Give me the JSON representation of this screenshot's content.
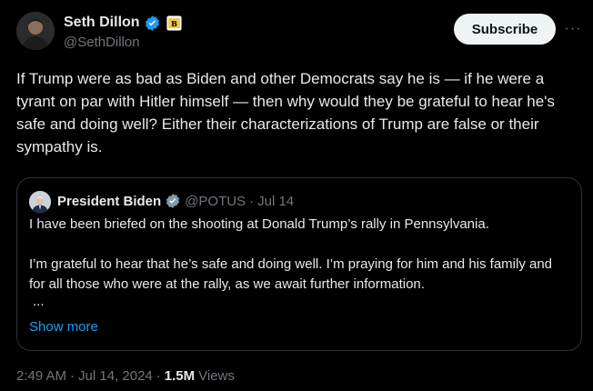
{
  "author": {
    "display_name": "Seth Dillon",
    "handle": "@SethDillon"
  },
  "subscribe_label": "Subscribe",
  "more_label": "···",
  "tweet_text": "If Trump were as bad as Biden and other Democrats say he is — if he were a tyrant on par with Hitler himself — then why would they be grateful to hear he's safe and doing well? Either their characterizations of Trump are false or their sympathy is.",
  "quote": {
    "display_name": "President Biden",
    "handle": "@POTUS",
    "separator": "·",
    "date": "Jul 14",
    "line1": "I have been briefed on the shooting at Donald Trump’s rally in Pennsylvania.",
    "line2": "I’m grateful to hear that he’s safe and doing well. I’m praying for him and his family and for all those who were at the rally, as we await further information.",
    "ellipsis": "...",
    "show_more": "Show more"
  },
  "meta": {
    "time": "2:49 AM",
    "dot1": "·",
    "date": "Jul 14, 2024",
    "dot2": "·",
    "views_count": "1.5M",
    "views_label": "Views"
  },
  "colors": {
    "background": "#000000",
    "text": "#e7e9ea",
    "secondary": "#71767b",
    "link": "#1d9bf0",
    "verified": "#1d9bf0",
    "border": "#2f3336"
  }
}
